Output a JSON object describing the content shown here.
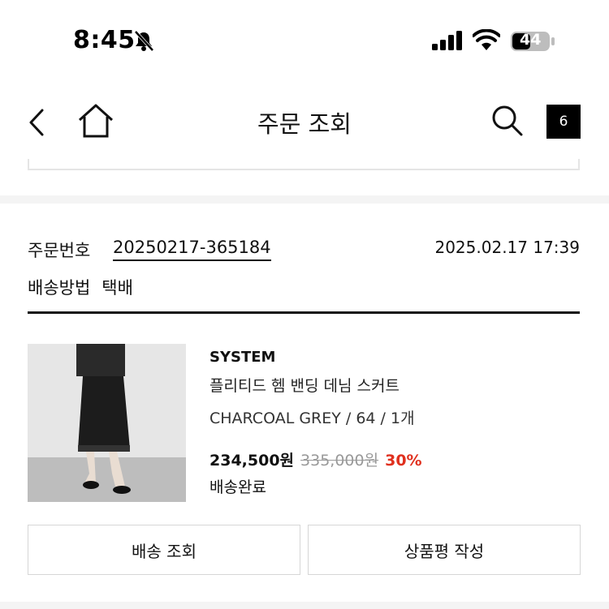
{
  "status_bar": {
    "time": "8:45",
    "battery": "44",
    "icons": [
      "bell-slash-icon",
      "cellular-signal-icon",
      "wifi-icon",
      "battery-icon"
    ]
  },
  "nav": {
    "title": "주문 조회",
    "cart_count": "6",
    "icons": [
      "back-icon",
      "home-icon",
      "search-icon"
    ]
  },
  "order": {
    "number_label": "주문번호",
    "number": "20250217-365184",
    "date": "2025.02.17 17:39",
    "shipping_label": "배송방법",
    "shipping_method": "택배"
  },
  "product": {
    "brand": "SYSTEM",
    "name": "플리티드 헴 밴딩 데님 스커트",
    "option": "CHARCOAL GREY  / 64  / 1개",
    "price": "234,500원",
    "original_price": "335,000원",
    "discount": "30%",
    "status": "배송완료"
  },
  "actions": {
    "track_label": "배송 조회",
    "review_label": "상품평 작성"
  },
  "colors": {
    "accent_discount": "#e0301e",
    "text": "#111111",
    "divider": "#f4f4f4"
  }
}
